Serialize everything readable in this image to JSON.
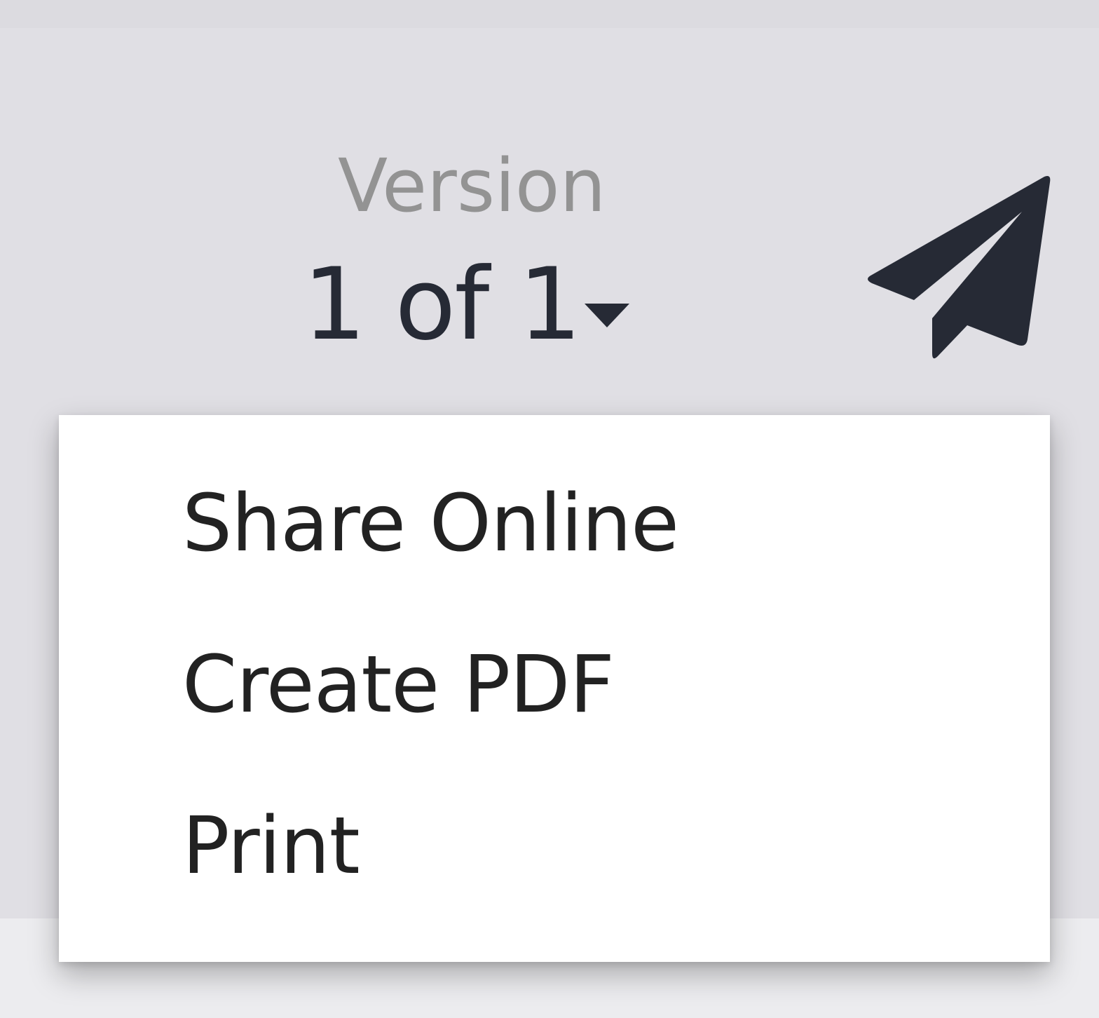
{
  "version": {
    "label": "Version",
    "value": "1 of 1"
  },
  "share_menu": {
    "items": [
      {
        "label": "Share Online"
      },
      {
        "label": "Create PDF"
      },
      {
        "label": "Print"
      }
    ]
  },
  "icons": {
    "send": "paper-plane-icon",
    "dropdown": "caret-down-icon"
  },
  "colors": {
    "background": "#e0dfe4",
    "icon": "#262a35",
    "label_muted": "#939393",
    "menu_bg": "#ffffff"
  }
}
